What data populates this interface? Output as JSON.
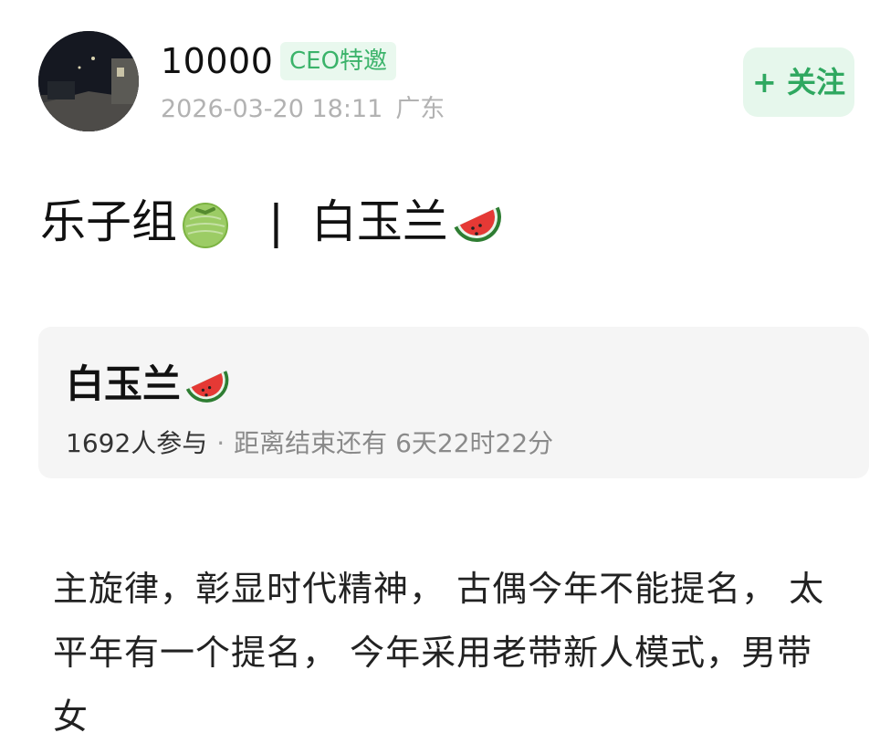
{
  "author": {
    "name": "10000",
    "badge": "CEO特邀",
    "timestamp": "2026-03-20 18:11",
    "location": "广东",
    "avatar_icon": "night-street-avatar"
  },
  "follow_button": {
    "label": "+ 关注"
  },
  "post": {
    "title_left": "乐子组",
    "title_separator": "|",
    "title_right": "白玉兰",
    "title_left_emoji": "melon-icon",
    "title_right_emoji": "watermelon-icon"
  },
  "vote": {
    "title": "白玉兰",
    "title_emoji": "watermelon-icon",
    "participants": "1692人参与",
    "separator": "·",
    "time_left": "距离结束还有 6天22时22分"
  },
  "body": {
    "text": "主旋律，彰显时代精神， 古偶今年不能提名， 太平年有一个提名， 今年采用老带新人模式，男带女"
  },
  "colors": {
    "accent_green": "#2fa860",
    "badge_bg": "#e9f8ee",
    "card_bg": "#f5f5f5",
    "muted_text": "#b2b2b2"
  }
}
